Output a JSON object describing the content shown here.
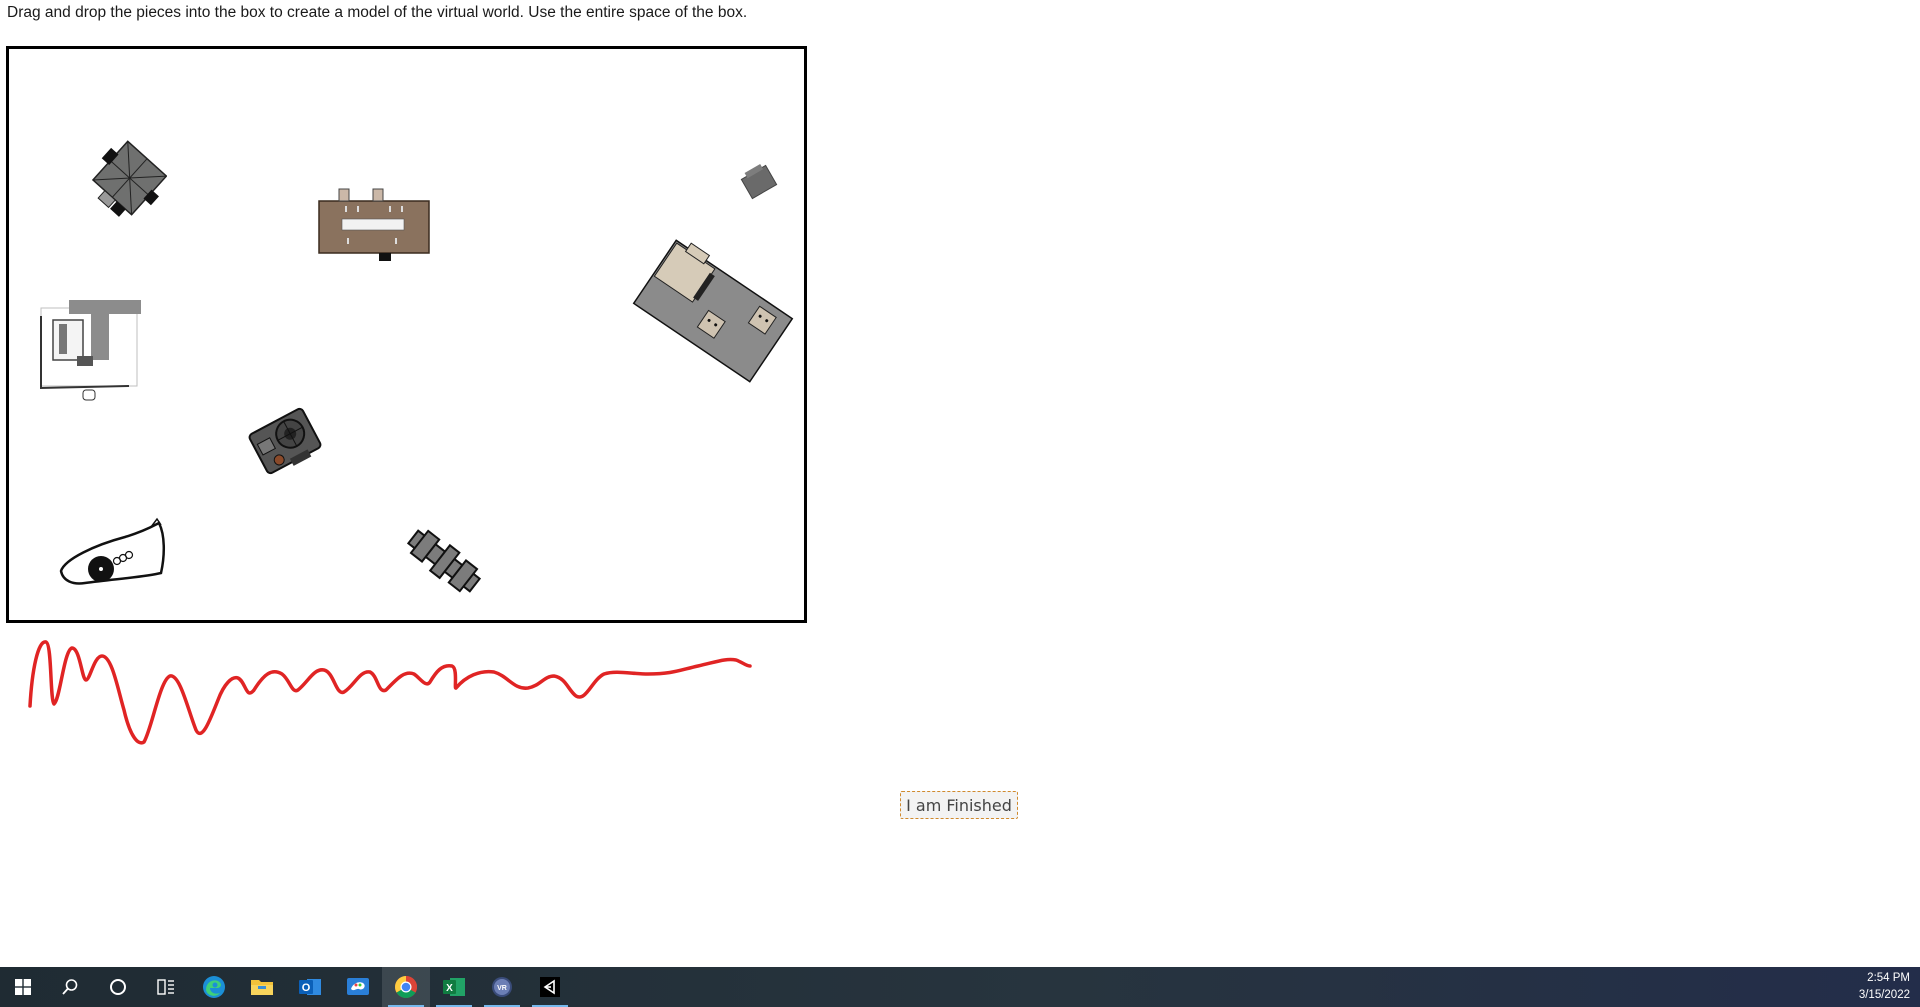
{
  "instructions": "Drag and drop the pieces into the box to create a model of the virtual world. Use the entire space of the box.",
  "workspace": {
    "pieces": [
      {
        "name": "piece-gray-octagon-building"
      },
      {
        "name": "piece-brown-long-building"
      },
      {
        "name": "piece-small-gray-block"
      },
      {
        "name": "piece-gray-rectangular-building"
      },
      {
        "name": "piece-white-t-shaped-building"
      },
      {
        "name": "piece-dark-circular-machine"
      },
      {
        "name": "piece-white-vehicle-shape"
      },
      {
        "name": "piece-gray-cross-shape"
      }
    ]
  },
  "finish_button": {
    "label": "I am Finished"
  },
  "taskbar": {
    "apps": [
      {
        "name": "start-button",
        "icon": "windows-icon"
      },
      {
        "name": "search-button",
        "icon": "search-icon"
      },
      {
        "name": "cortana-button",
        "icon": "circle-icon"
      },
      {
        "name": "task-view-button",
        "icon": "task-view-icon"
      },
      {
        "name": "edge-app",
        "icon": "edge-icon"
      },
      {
        "name": "file-explorer-app",
        "icon": "folder-icon"
      },
      {
        "name": "outlook-app",
        "icon": "outlook-icon"
      },
      {
        "name": "paint-app",
        "icon": "paint-icon"
      },
      {
        "name": "chrome-app",
        "icon": "chrome-icon"
      },
      {
        "name": "excel-app",
        "icon": "excel-icon"
      },
      {
        "name": "vr-app",
        "icon": "vr-icon"
      },
      {
        "name": "unity-app",
        "icon": "unity-icon"
      }
    ],
    "outlook_letter": "O",
    "excel_letter": "X",
    "vr_label": "VR",
    "time": "2:54 PM",
    "date": "3/15/2022"
  }
}
